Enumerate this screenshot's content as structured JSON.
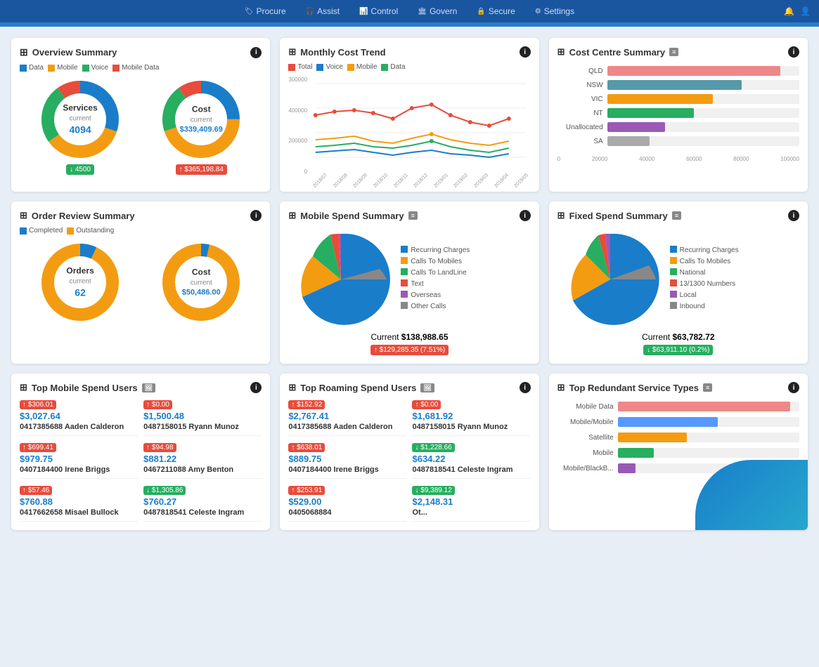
{
  "nav": {
    "items": [
      {
        "label": "Procure",
        "icon": "🏷"
      },
      {
        "label": "Assist",
        "icon": "🎧"
      },
      {
        "label": "Control",
        "icon": "📊"
      },
      {
        "label": "Govern",
        "icon": "🏛"
      },
      {
        "label": "Secure",
        "icon": "🔒"
      },
      {
        "label": "Settings",
        "icon": "⚙"
      }
    ]
  },
  "overview": {
    "title": "Overview Summary",
    "legend": [
      "Data",
      "Mobile",
      "Voice",
      "Mobile Data"
    ],
    "legend_colors": [
      "#1a7dc9",
      "#f39c12",
      "#27ae60",
      "#e74c3c"
    ],
    "services_label": "Services",
    "services_sub": "current",
    "services_num": "4094",
    "services_badge": "↓ 4500",
    "cost_label": "Cost",
    "cost_sub": "current",
    "cost_num": "$339,409.69",
    "cost_badge": "↑ $365,198.84"
  },
  "monthly": {
    "title": "Monthly Cost Trend",
    "legend": [
      "Total",
      "Voice",
      "Mobile",
      "Data"
    ],
    "legend_colors": [
      "#e74c3c",
      "#1a7dc9",
      "#f39c12",
      "#27ae60"
    ],
    "y_labels": [
      "300000",
      "400000",
      "200000",
      "0"
    ],
    "x_labels": [
      "2018/07",
      "2018/08",
      "2018/09",
      "2018/10",
      "2018/11",
      "2018/12",
      "2019/01",
      "2019/02",
      "2019/03",
      "2019/04",
      "2019/05"
    ]
  },
  "cost_centre": {
    "title": "Cost Centre Summary",
    "bars": [
      {
        "label": "QLD",
        "value": 90,
        "color": "#e88"
      },
      {
        "label": "NSW",
        "value": 70,
        "color": "#59a"
      },
      {
        "label": "VIC",
        "value": 55,
        "color": "#f39c12"
      },
      {
        "label": "NT",
        "value": 45,
        "color": "#27ae60"
      },
      {
        "label": "Unallocated",
        "value": 30,
        "color": "#9b59b6"
      },
      {
        "label": "SA",
        "value": 22,
        "color": "#aaa"
      }
    ],
    "x_labels": [
      "0",
      "20000",
      "40000",
      "60000",
      "80000",
      "100000"
    ]
  },
  "order_review": {
    "title": "Order Review Summary",
    "legend": [
      "Completed",
      "Outstanding"
    ],
    "legend_colors": [
      "#1a7dc9",
      "#f39c12"
    ],
    "orders_label": "Orders",
    "orders_sub": "current",
    "orders_num": "62",
    "cost_label": "Cost",
    "cost_sub": "current",
    "cost_num": "$50,486.00"
  },
  "mobile_spend": {
    "title": "Mobile Spend Summary",
    "current_label": "Current",
    "current_value": "$138,988.65",
    "badge": "↑ $129,285.35 (7.51%)",
    "legend": [
      {
        "label": "Recurring Charges",
        "color": "#1a7dc9"
      },
      {
        "label": "Calls To Mobiles",
        "color": "#f39c12"
      },
      {
        "label": "Calls To LandLine",
        "color": "#27ae60"
      },
      {
        "label": "Text",
        "color": "#e74c3c"
      },
      {
        "label": "Overseas",
        "color": "#9b59b6"
      },
      {
        "label": "Other Calls",
        "color": "#888"
      }
    ]
  },
  "fixed_spend": {
    "title": "Fixed Spend Summary",
    "current_label": "Current",
    "current_value": "$63,782.72",
    "badge": "↓ $63,911.10 (0.2%)",
    "legend": [
      {
        "label": "Recurring Charges",
        "color": "#1a7dc9"
      },
      {
        "label": "Calls To Mobiles",
        "color": "#f39c12"
      },
      {
        "label": "National",
        "color": "#27ae60"
      },
      {
        "label": "13/1300 Numbers",
        "color": "#e74c3c"
      },
      {
        "label": "Local",
        "color": "#9b59b6"
      },
      {
        "label": "Inbound",
        "color": "#888"
      }
    ]
  },
  "top_mobile": {
    "title": "Top Mobile Spend Users",
    "users": [
      {
        "badge": "↑ $306.01",
        "badge_type": "red",
        "amount": "$3,027.64",
        "phone": "0417385688",
        "name": "Aaden Calderon"
      },
      {
        "badge": "↑ $0.00",
        "badge_type": "red",
        "amount": "$1,500.48",
        "phone": "0487158015",
        "name": "Ryann Munoz"
      },
      {
        "badge": "↑ $699.41",
        "badge_type": "red",
        "amount": "$979.75",
        "phone": "0407184400",
        "name": "Irene Briggs"
      },
      {
        "badge": "↑ $94.98",
        "badge_type": "red",
        "amount": "$881.22",
        "phone": "0467211088",
        "name": "Amy Benton"
      },
      {
        "badge": "↑ $57.46",
        "badge_type": "red",
        "amount": "$760.88",
        "phone": "0417662658",
        "name": "Misael Bullock"
      },
      {
        "badge": "↓ $1,305.86",
        "badge_type": "green",
        "amount": "$760.27",
        "phone": "0487818541",
        "name": "Celeste Ingram"
      }
    ]
  },
  "top_roaming": {
    "title": "Top Roaming Spend Users",
    "users": [
      {
        "badge": "↑ $152.92",
        "badge_type": "red",
        "amount": "$2,767.41",
        "phone": "0417385688",
        "name": "Aaden Calderon"
      },
      {
        "badge": "↑ $0.00",
        "badge_type": "red",
        "amount": "$1,681.92",
        "phone": "0487158015",
        "name": "Ryann Munoz"
      },
      {
        "badge": "↑ $638.01",
        "badge_type": "red",
        "amount": "$889.75",
        "phone": "0407184400",
        "name": "Irene Briggs"
      },
      {
        "badge": "↓ $1,228.66",
        "badge_type": "green",
        "amount": "$634.22",
        "phone": "0487818541",
        "name": "Celeste Ingram"
      },
      {
        "badge": "↑ $253.91",
        "badge_type": "red",
        "amount": "$529.00",
        "phone": "0405068884",
        "name": ""
      },
      {
        "badge": "↓ $9,389.12",
        "badge_type": "green",
        "amount": "$2,148.31",
        "phone": "",
        "name": "Ot..."
      }
    ]
  },
  "top_redundant": {
    "title": "Top Redundant Service Types",
    "bars": [
      {
        "label": "Mobile Data",
        "value": 95,
        "color": "#e88"
      },
      {
        "label": "Mobile/Mobile",
        "value": 55,
        "color": "#59f"
      },
      {
        "label": "Satellite",
        "value": 38,
        "color": "#f39c12"
      },
      {
        "label": "Mobile",
        "value": 20,
        "color": "#27ae60"
      },
      {
        "label": "Mobile/BlackB...",
        "value": 10,
        "color": "#9b59b6"
      }
    ]
  }
}
